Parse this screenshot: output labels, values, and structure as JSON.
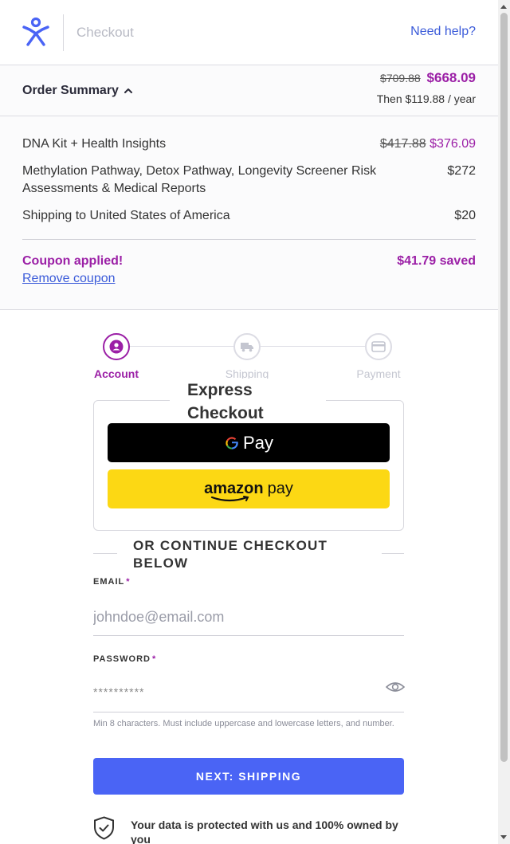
{
  "header": {
    "title": "Checkout",
    "help_link": "Need help?"
  },
  "summary": {
    "toggle_label": "Order Summary",
    "original_total": "$709.88",
    "total": "$668.09",
    "renewal": "Then $119.88 / year"
  },
  "order_lines": [
    {
      "label": "DNA Kit + Health Insights",
      "original_price": "$417.88",
      "price": "$376.09"
    },
    {
      "label": "Methylation Pathway, Detox Pathway, Longevity Screener Risk Assessments & Medical Reports",
      "price": "$272"
    },
    {
      "label": "Shipping to United States of America",
      "price": "$20"
    }
  ],
  "coupon": {
    "status": "Coupon applied!",
    "saved": "$41.79 saved",
    "remove_link": "Remove coupon"
  },
  "steps": [
    {
      "label": "Account",
      "icon": "user-icon",
      "active": true
    },
    {
      "label": "Shipping",
      "icon": "truck-icon",
      "active": false
    },
    {
      "label": "Payment",
      "icon": "credit-card-icon",
      "active": false
    }
  ],
  "express": {
    "title": "Express Checkout",
    "gpay_label": "Pay",
    "gpay_letter": "G",
    "amazon_word": "amazon",
    "amazon_pay": "pay"
  },
  "divider_text": "OR CONTINUE CHECKOUT BELOW",
  "form": {
    "email_label": "EMAIL",
    "email_placeholder": "johndoe@email.com",
    "password_label": "PASSWORD",
    "password_placeholder": "**********",
    "required_mark": "*",
    "password_hint": "Min 8 characters. Must include uppercase and lowercase letters, and number.",
    "next_button": "NEXT: SHIPPING"
  },
  "secure_note": "Your data is protected with us and 100% owned by you",
  "colors": {
    "brand_purple": "#9b1fa6",
    "link_blue": "#3b5bd9",
    "primary_button": "#4a64f5",
    "logo_blue": "#4a64f5"
  }
}
